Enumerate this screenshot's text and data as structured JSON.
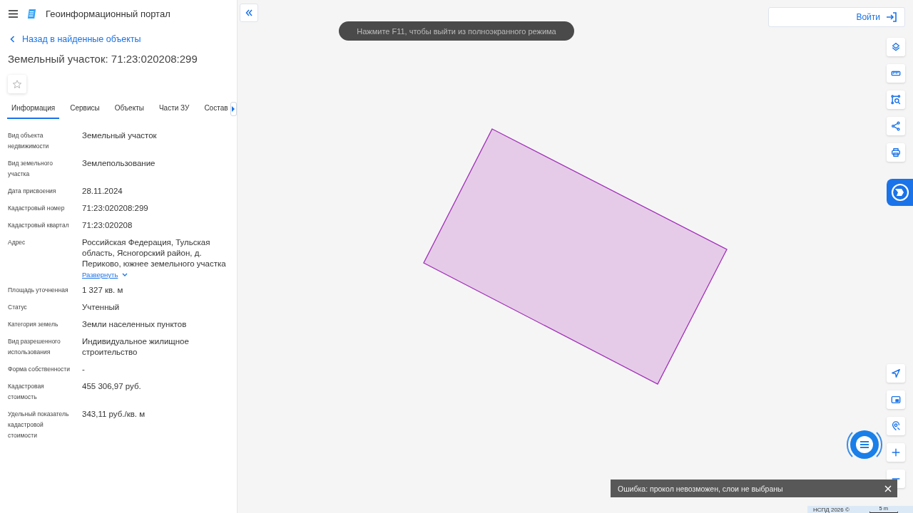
{
  "header": {
    "title": "Геоинформационный портал"
  },
  "back_link": "Назад в найденные объекты",
  "object_title": "Земельный участок: 71:23:020208:299",
  "favorite": {
    "on": false
  },
  "tabs": [
    {
      "label": "Информация",
      "selected": true
    },
    {
      "label": "Сервисы",
      "selected": false
    },
    {
      "label": "Объекты",
      "selected": false
    },
    {
      "label": "Части ЗУ",
      "selected": false
    },
    {
      "label": "Состав",
      "selected": false
    }
  ],
  "properties": [
    {
      "label": "Вид объекта недвижимости",
      "value": "Земельный участок"
    },
    {
      "label": "Вид земельного участка",
      "value": "Землепользование"
    },
    {
      "label": "Дата присвоения",
      "value": "28.11.2024"
    },
    {
      "label": "Кадастровый номер",
      "value": "71:23:020208:299"
    },
    {
      "label": "Кадастровый квартал",
      "value": "71:23:020208"
    },
    {
      "label": "Адрес",
      "value": "Российская Федерация, Тульская область, Ясногорский район, д. Периково, южнее земельного участка",
      "link": "Развернуть"
    },
    {
      "label": "Площадь уточненная",
      "value": "1 327 кв. м"
    },
    {
      "label": "Статус",
      "value": "Учтенный"
    },
    {
      "label": "Категория земель",
      "value": "Земли населенных пунктов"
    },
    {
      "label": "Вид разрешенного использования",
      "value": "Индивидуальное жилищное строительство"
    },
    {
      "label": "Форма собственности",
      "value": "-"
    },
    {
      "label": "Кадастровая стоимость",
      "value": "455 306,97 руб."
    },
    {
      "label": "Удельный показатель кадастровой стоимости",
      "value": "343,11 руб./кв. м"
    }
  ],
  "map": {
    "fullscreen_hint": "Нажмите F11, чтобы выйти из полноэкранного режима",
    "login_button": "Войти",
    "toast": "Ошибка: прокол невозможен, слои не выбраны",
    "attribution": "НСПД 2026 ©",
    "scale": "5 m"
  }
}
